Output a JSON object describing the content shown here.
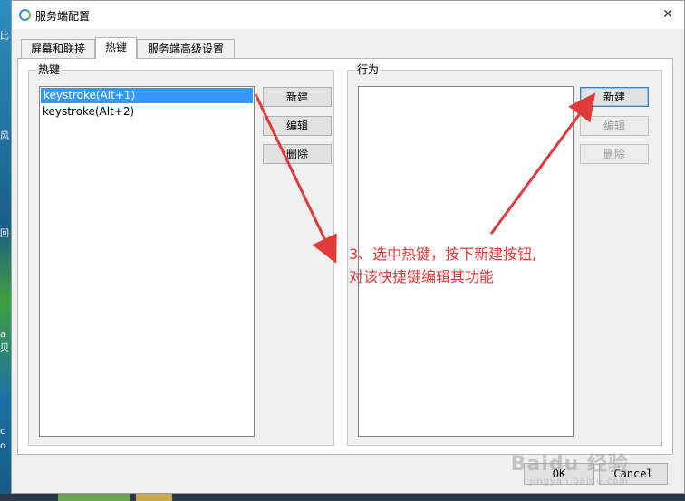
{
  "window": {
    "title": "服务端配置",
    "close_glyph": "✕"
  },
  "tabs": [
    {
      "label": "屏幕和联接",
      "active": false
    },
    {
      "label": "热键",
      "active": true
    },
    {
      "label": "服务端高级设置",
      "active": false
    }
  ],
  "hotkeys_group": {
    "label": "热键",
    "items": [
      {
        "label": "keystroke(Alt+1)",
        "selected": true
      },
      {
        "label": "keystroke(Alt+2)",
        "selected": false
      }
    ],
    "buttons": {
      "new": "新建",
      "edit": "编辑",
      "delete": "删除"
    }
  },
  "actions_group": {
    "label": "行为",
    "items": [],
    "buttons": {
      "new": "新建",
      "edit": "编辑",
      "delete": "删除"
    },
    "disabled": [
      "edit",
      "delete"
    ]
  },
  "footer": {
    "ok": "OK",
    "cancel": "Cancel"
  },
  "annotation": {
    "line1": "3、选中热键，按下新建按钮,",
    "line2": "对该快捷键编辑其功能",
    "color": "#e23a3a"
  },
  "desktop_edge_text": [
    "比",
    "风",
    "回",
    "a",
    "贝",
    "c",
    "o"
  ],
  "watermark": {
    "text": "Baidu 经验",
    "sub": "jingyan.baidu.com"
  },
  "colors": {
    "selection": "#3399ff",
    "annotation": "#e23a3a",
    "accent": "#3c7fb1"
  }
}
